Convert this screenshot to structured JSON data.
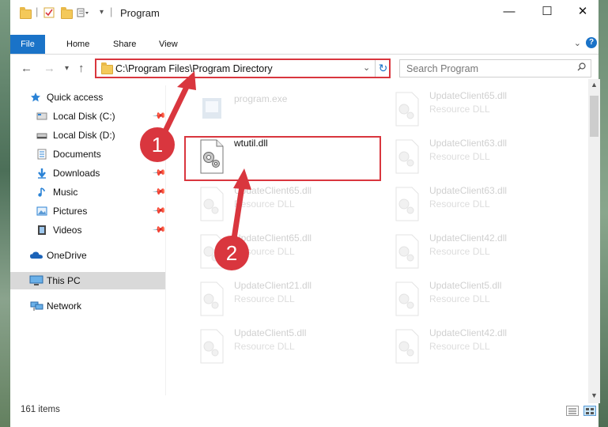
{
  "window": {
    "title": "Program",
    "minimize_glyph": "—",
    "maximize_glyph": "☐",
    "close_glyph": "✕"
  },
  "ribbon": {
    "tabs": [
      {
        "label": "File"
      },
      {
        "label": "Home"
      },
      {
        "label": "Share"
      },
      {
        "label": "View"
      }
    ],
    "help_glyph": "?"
  },
  "address_bar": {
    "path": "C:\\Program Files\\Program Directory"
  },
  "search": {
    "placeholder": "Search Program"
  },
  "sidebar": {
    "items": [
      {
        "label": "Quick access",
        "icon": "star-icon"
      },
      {
        "label": "Local Disk (C:)",
        "icon": "drive-icon",
        "pinned": true
      },
      {
        "label": "Local Disk (D:)",
        "icon": "drive-icon"
      },
      {
        "label": "Documents",
        "icon": "documents-icon"
      },
      {
        "label": "Downloads",
        "icon": "download-arrow-icon",
        "pinned": true
      },
      {
        "label": "Music",
        "icon": "music-note-icon",
        "pinned": true
      },
      {
        "label": "Pictures",
        "icon": "pictures-icon",
        "pinned": true
      },
      {
        "label": "Videos",
        "icon": "film-icon",
        "pinned": true
      },
      {
        "label": "OneDrive",
        "icon": "cloud-icon"
      },
      {
        "label": "This PC",
        "icon": "monitor-icon"
      },
      {
        "label": "Network",
        "icon": "network-icon"
      }
    ]
  },
  "files": [
    {
      "name": "program.exe",
      "type": "",
      "faded": true
    },
    {
      "name": "UpdateClient65.dll",
      "type": "Resource DLL",
      "faded": true
    },
    {
      "name": "wtutil.dll",
      "type": "",
      "faded": false
    },
    {
      "name": "UpdateClient63.dll",
      "type": "Resource DLL",
      "faded": true
    },
    {
      "name": "UpdateClient65.dll",
      "type": "Resource DLL",
      "faded": true
    },
    {
      "name": "UpdateClient63.dll",
      "type": "Resource DLL",
      "faded": true
    },
    {
      "name": "UpdateClient65.dll",
      "type": "Resource DLL",
      "faded": true
    },
    {
      "name": "UpdateClient42.dll",
      "type": "Resource DLL",
      "faded": true
    },
    {
      "name": "UpdateClient21.dll",
      "type": "Resource DLL",
      "faded": true
    },
    {
      "name": "UpdateClient5.dll",
      "type": "Resource DLL",
      "faded": true
    },
    {
      "name": "UpdateClient5.dll",
      "type": "Resource DLL",
      "faded": true
    },
    {
      "name": "UpdateClient42.dll",
      "type": "Resource DLL",
      "faded": true
    }
  ],
  "status": {
    "item_count": "161 items"
  },
  "callouts": {
    "one": "1",
    "two": "2"
  },
  "colors": {
    "accent": "#1a73c8",
    "annotation_red": "#d9363e",
    "selection": "#cde8f8"
  }
}
